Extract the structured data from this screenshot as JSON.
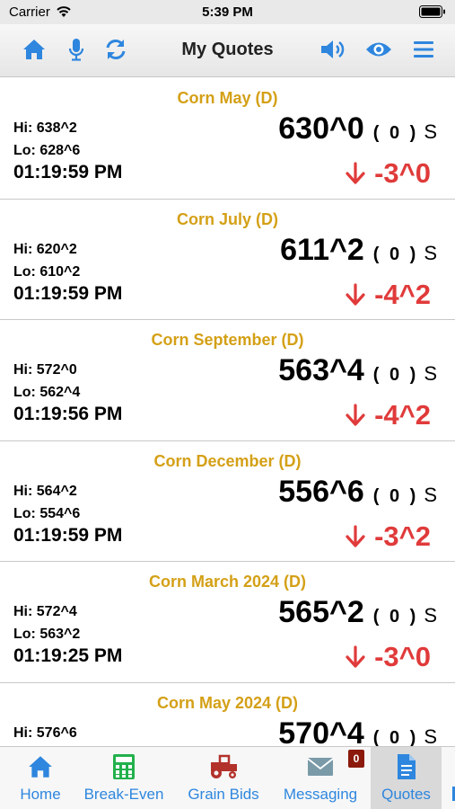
{
  "status_bar": {
    "carrier": "Carrier",
    "time": "5:39 PM"
  },
  "header": {
    "title": "My Quotes",
    "icons": [
      "home-icon",
      "microphone-icon",
      "refresh-icon",
      "speaker-icon",
      "eye-icon",
      "menu-icon"
    ],
    "icon_color": "#2e86de"
  },
  "quotes": [
    {
      "name": "Corn May (D)",
      "hi": "Hi: 638^2",
      "lo": "Lo: 628^6",
      "time": "01:19:59 PM",
      "price": "630^0",
      "volume": "( 0 )",
      "flag": "S",
      "change": "-3^0"
    },
    {
      "name": "Corn July (D)",
      "hi": "Hi: 620^2",
      "lo": "Lo: 610^2",
      "time": "01:19:59 PM",
      "price": "611^2",
      "volume": "( 0 )",
      "flag": "S",
      "change": "-4^2"
    },
    {
      "name": "Corn September (D)",
      "hi": "Hi: 572^0",
      "lo": "Lo: 562^4",
      "time": "01:19:56 PM",
      "price": "563^4",
      "volume": "( 0 )",
      "flag": "S",
      "change": "-4^2"
    },
    {
      "name": "Corn December (D)",
      "hi": "Hi: 564^2",
      "lo": "Lo: 554^6",
      "time": "01:19:59 PM",
      "price": "556^6",
      "volume": "( 0 )",
      "flag": "S",
      "change": "-3^2"
    },
    {
      "name": "Corn March 2024 (D)",
      "hi": "Hi: 572^4",
      "lo": "Lo: 563^2",
      "time": "01:19:25 PM",
      "price": "565^2",
      "volume": "( 0 )",
      "flag": "S",
      "change": "-3^0"
    },
    {
      "name": "Corn May 2024 (D)",
      "hi": "Hi: 576^6",
      "lo": "",
      "time": "",
      "price": "570^4",
      "volume": "( 0 )",
      "flag": "S",
      "change": ""
    }
  ],
  "colors": {
    "name": "#d4a017",
    "change_down": "#e03a3a",
    "accent": "#2e86de",
    "badge": "#8b1a0c"
  },
  "tab_bar": {
    "tabs": [
      {
        "label": "Home",
        "icon": "home-icon"
      },
      {
        "label": "Break-Even",
        "icon": "calculator-icon"
      },
      {
        "label": "Grain Bids",
        "icon": "tractor-icon"
      },
      {
        "label": "Messaging",
        "icon": "envelope-icon",
        "badge": "0"
      },
      {
        "label": "Quotes",
        "icon": "document-icon",
        "active": true
      }
    ]
  }
}
